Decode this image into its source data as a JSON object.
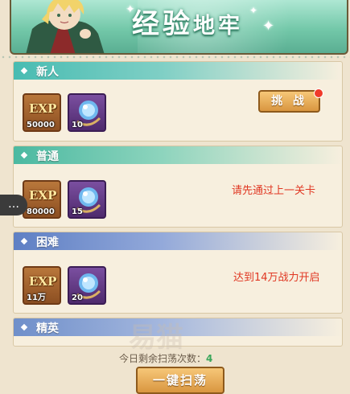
{
  "header": {
    "title_big": "经验",
    "title_small": "地牢"
  },
  "sections": [
    {
      "name": "新人",
      "rewards": [
        {
          "type": "exp",
          "glyph": "EXP",
          "qty": "50000"
        },
        {
          "type": "orb",
          "qty": "10"
        }
      ],
      "action": "挑 战"
    },
    {
      "name": "普通",
      "rewards": [
        {
          "type": "exp",
          "glyph": "EXP",
          "qty": "80000"
        },
        {
          "type": "orb",
          "qty": "15"
        }
      ],
      "status": "请先通过上一关卡"
    },
    {
      "name": "困难",
      "rewards": [
        {
          "type": "exp",
          "glyph": "EXP",
          "qty": "11万"
        },
        {
          "type": "orb",
          "qty": "20"
        }
      ],
      "status": "达到14万战力开启"
    },
    {
      "name": "精英"
    }
  ],
  "chat_icon": "…",
  "footer": {
    "sweep_label": "今日剩余扫荡次数：",
    "sweep_count": "4",
    "sweep_button": "一键扫荡"
  },
  "watermark": "易猫",
  "colors": {
    "accent_red": "#e03722",
    "button_gold": "#d99640",
    "count_green": "#3aa65a"
  }
}
